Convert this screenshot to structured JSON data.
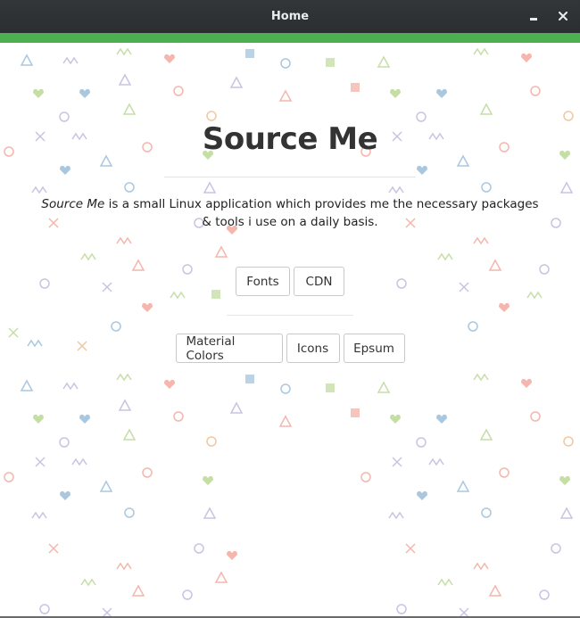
{
  "window": {
    "title": "Home",
    "minimize_icon": "minimize-icon",
    "close_icon": "close-icon",
    "accent_color": "#4caf50",
    "titlebar_color": "#2b2e31"
  },
  "hero": {
    "title": "Source Me",
    "description_app_name": "Source Me",
    "description_text": " is a small Linux application which provides me the necessary packages & tools i use on a daily basis."
  },
  "buttons": {
    "row1": [
      {
        "label": "Fonts"
      },
      {
        "label": "CDN"
      }
    ],
    "row2": [
      {
        "label": "Material Colors"
      },
      {
        "label": "Icons"
      },
      {
        "label": "Epsum"
      }
    ]
  },
  "background": {
    "pattern": "confetti-shapes",
    "colors": [
      "#f4b6ad",
      "#a9c8e0",
      "#c5dea6",
      "#c9c3e3",
      "#f0c8a0"
    ]
  }
}
